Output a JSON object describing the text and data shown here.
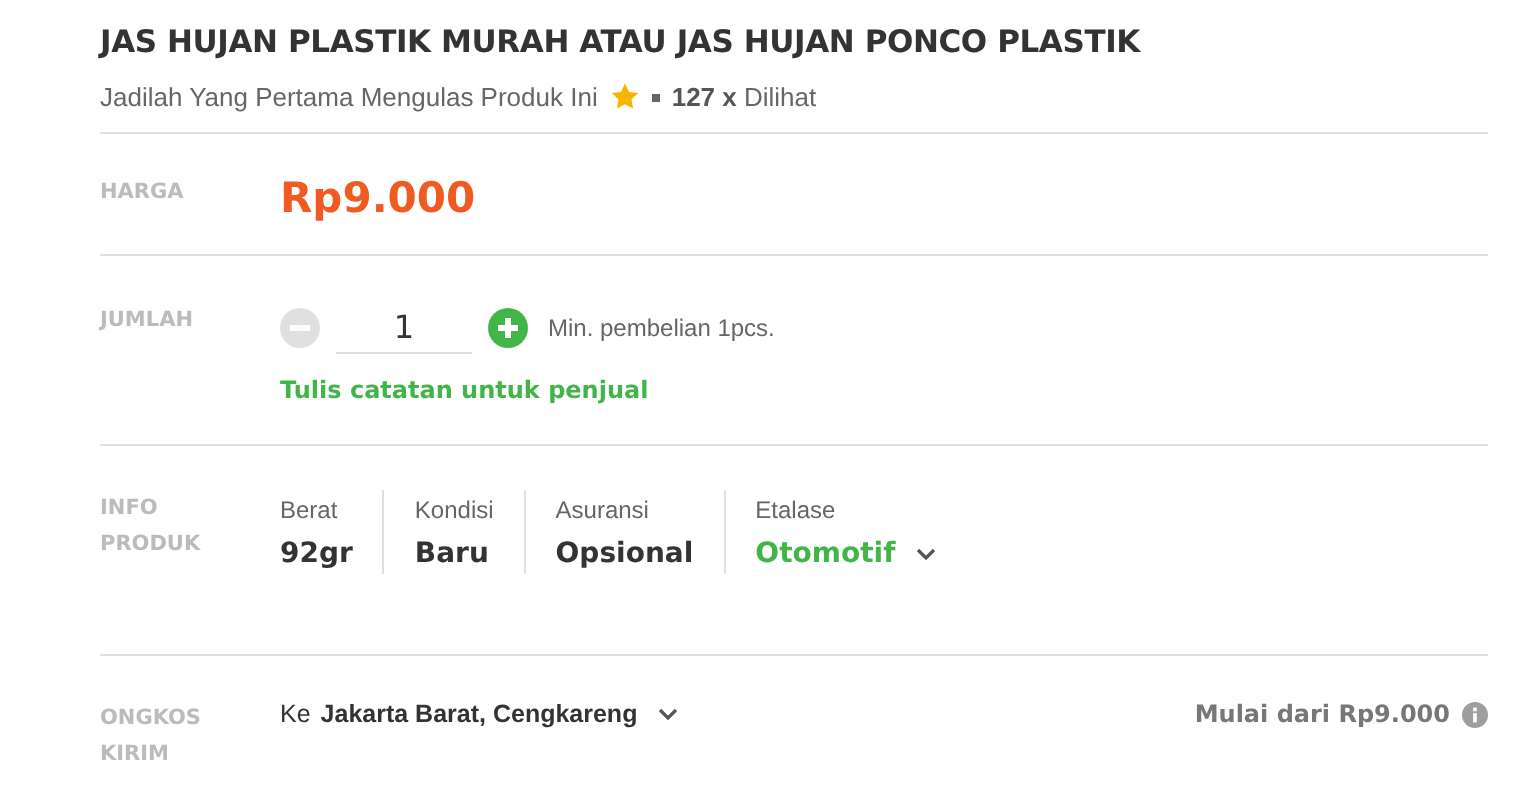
{
  "title": "JAS HUJAN PLASTIK MURAH ATAU JAS HUJAN PONCO PLASTIK",
  "subtitle": {
    "review_prompt": "Jadilah Yang Pertama Mengulas Produk Ini",
    "views": "**127 x** Dilihat"
  },
  "price": {
    "label": "HARGA",
    "value": "Rp9.000"
  },
  "quantity": {
    "label": "JUMLAH",
    "value": "1",
    "minus_disabled": true,
    "plus_disabled": false,
    "min_note": "Min. pembelian 1pcs.",
    "note_link": "Tulis catatan untuk penjual"
  },
  "info": {
    "label": [
      "INFO",
      "PRODUK"
    ],
    "items": [
      {
        "label": "Berat",
        "value": "92gr",
        "kind": "plain"
      },
      {
        "label": "Kondisi",
        "value": "Baru",
        "kind": "plain"
      },
      {
        "label": "Asuransi",
        "value": "Opsional",
        "kind": "plain"
      },
      {
        "label": "Etalase",
        "value": "Otomotif",
        "kind": "dropdown"
      }
    ]
  },
  "shipping": {
    "label": [
      "ONGKOS",
      "KIRIM"
    ],
    "prefix": "Ke",
    "destination": "Jakarta Barat, Cengkareng",
    "price_note": "Mulai dari Rp9.000"
  }
}
